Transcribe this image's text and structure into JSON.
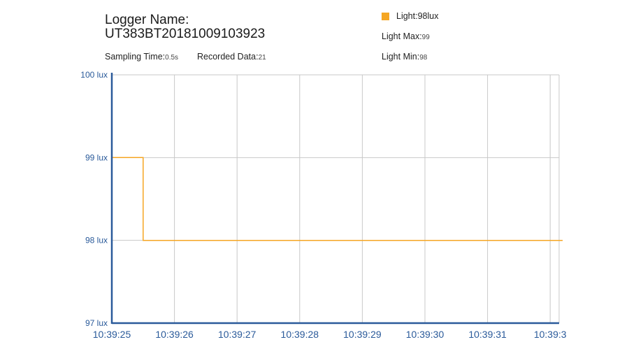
{
  "header": {
    "logger_label": "Logger Name:",
    "logger_id": "UT383BT20181009103923",
    "sampling_label": "Sampling Time:",
    "sampling_value": "0.5s",
    "recorded_label": "Recorded Data:",
    "recorded_value": "21"
  },
  "legend": {
    "label": "Light:98lux",
    "max_label": "Light Max:",
    "max_value": "99",
    "min_label": "Light Min:",
    "min_value": "98"
  },
  "colors": {
    "series": "#f5a623",
    "axis": "#2a5a9a",
    "grid": "#c8c8c8",
    "tick_text": "#2a5a9a"
  },
  "chart_data": {
    "type": "line",
    "step": true,
    "x_tick_labels": [
      "10:39:25",
      "10:39:26",
      "10:39:27",
      "10:39:28",
      "10:39:29",
      "10:39:30",
      "10:39:31",
      "10:39:3"
    ],
    "y_tick_labels": [
      "100 lux",
      "99 lux",
      "98 lux",
      "97 lux"
    ],
    "y_ticks": [
      100,
      99,
      98,
      97
    ],
    "ylim": [
      97,
      100
    ],
    "x_unit": "seconds after 10:39:25",
    "xlim": [
      0,
      7.2
    ],
    "series": [
      {
        "values_x": [
          0,
          0.5,
          0.5,
          7.2
        ],
        "values_y": [
          99,
          99,
          98,
          98
        ]
      }
    ],
    "grid": true
  }
}
